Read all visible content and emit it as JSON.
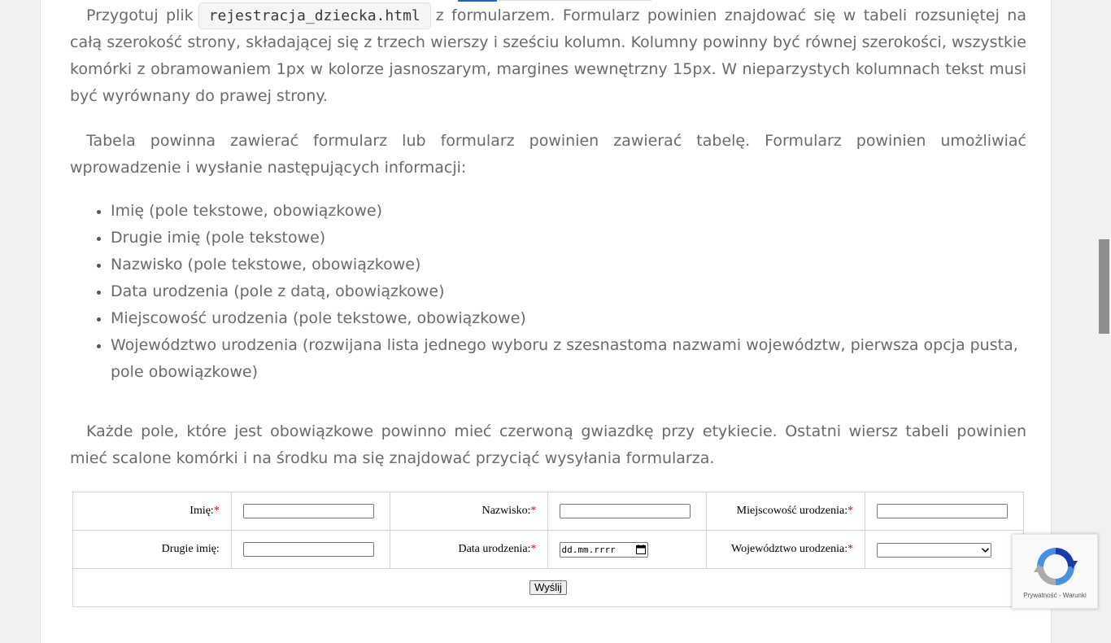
{
  "paragraph1": {
    "before_code": "Przygotuj plik",
    "code": "rejestracja_dziecka.html",
    "after_code": "z formularzem. Formularz powinien znajdować się w tabeli rozsuniętej na całą szerokość strony, składającej się z trzech wierszy i sześciu kolumn. Kolumny powinny być równej szerokości, wszystkie komórki z obramowaniem 1px w kolorze jasnoszarym, margines wewnętrzny 15px. W nieparzystych kolumnach tekst musi być wyrównany do prawej strony."
  },
  "paragraph2": "Tabela powinna zawierać formularz lub formularz powinien zawierać tabelę. Formularz powinien umożliwiać wprowadzenie i wysłanie następujących informacji:",
  "requirements": [
    "Imię (pole tekstowe, obowiązkowe)",
    "Drugie imię (pole tekstowe)",
    "Nazwisko (pole tekstowe, obowiązkowe)",
    "Data urodzenia (pole z datą, obowiązkowe)",
    "Miejscowość urodzenia (pole tekstowe, obowiązkowe)",
    "Województwo urodzenia (rozwijana lista jednego wyboru z szesnastoma nazwami województw, pierwsza opcja pusta, pole obowiązkowe)"
  ],
  "paragraph3": "Każde pole, które jest obowiązkowe powinno mieć czerwoną gwiazdkę przy etykiecie. Ostatni wiersz tabeli powinien mieć scalone komórki i na środku ma się znajdować przyciąć wysyłania formularza.",
  "form": {
    "required_marker": "*",
    "first_name_label": "Imię:",
    "last_name_label": "Nazwisko:",
    "birth_place_label": "Miejscowość urodzenia:",
    "second_name_label": "Drugie imię:",
    "birth_date_label": "Data urodzenia:",
    "birth_date_placeholder": "dd.mm.rrrr",
    "province_label": "Województwo urodzenia:",
    "province_selected": "",
    "submit_label": "Wyślij"
  },
  "recaptcha": {
    "privacy": "Prywatność",
    "separator": " - ",
    "terms": "Warunki"
  },
  "colors": {
    "required": "#d40000",
    "body_text": "#6a6a6a",
    "cell_border": "#d3d3d3"
  }
}
